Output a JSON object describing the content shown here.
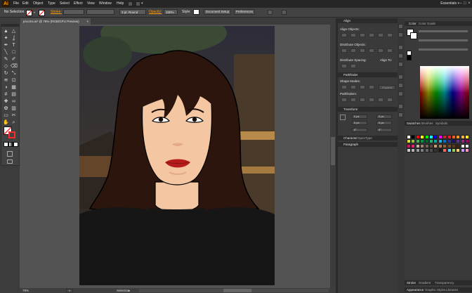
{
  "app": {
    "logo": "Ai",
    "workspace": "Essentials"
  },
  "menu": [
    "File",
    "Edit",
    "Object",
    "Type",
    "Select",
    "Effect",
    "View",
    "Window",
    "Help"
  ],
  "control_bar": {
    "selection_status": "No Selection",
    "stroke_label": "Stroke:",
    "stroke_value": "",
    "brush_label": "3 pt. Round",
    "opacity_label": "Opacity:",
    "opacity_value": "100%",
    "style_label": "Style:",
    "document_setup": "Document Setup",
    "preferences": "Preferences",
    "fill_color": "#ffffff",
    "stroke_color": "#ff0000"
  },
  "document": {
    "tab_title": "procms.ai* @ 78% (RGB/GPU Preview)",
    "zoom": "78%",
    "status_tool": "Selection",
    "page_number": "1"
  },
  "panels": {
    "align": {
      "title": "Align",
      "align_objects": "Align Objects:",
      "distribute_objects": "Distribute Objects:",
      "distribute_spacing": "Distribute Spacing:",
      "align_to": "Align To:"
    },
    "pathfinder": {
      "title": "Pathfinder",
      "shape_modes": "Shape Modes:",
      "expand": "Expand",
      "pathfinders": "Pathfinders:"
    },
    "transform": {
      "title": "Transform",
      "x_value": "0 px",
      "y_value": "0 px",
      "w_value": "0 px",
      "h_value": "0 px",
      "angle_value": "0°",
      "shear_value": "0°"
    },
    "character": {
      "title": "Character",
      "tab2": "OpenType"
    },
    "paragraph": {
      "title": "Paragraph"
    },
    "color": {
      "title": "Color",
      "tab2": "Color Guide"
    },
    "swatches": {
      "title": "Swatches",
      "tab2": "Brushes",
      "tab3": "Symbols"
    },
    "stroke_group": {
      "title": "Stroke",
      "tab2": "Gradient",
      "tab3": "Transparency"
    },
    "appearance_group": {
      "title": "Appearance",
      "tab2": "Graphic Styles",
      "tab3": "Libraries"
    }
  },
  "colors": {
    "hair": "#2b150d",
    "skin": "#f4c7a2",
    "lips": "#b51c1c",
    "shirt": "#161616",
    "accent": "#ff9a00"
  },
  "icons": {
    "tool_icons": [
      "selection",
      "direct-selection",
      "magic-wand",
      "lasso",
      "pen",
      "type",
      "line",
      "rectangle",
      "paintbrush",
      "pencil",
      "shaper",
      "eraser",
      "rotate",
      "scale",
      "width",
      "free-transform",
      "shape-builder",
      "perspective",
      "mesh",
      "gradient",
      "eyedropper",
      "blend",
      "symbol-sprayer",
      "column-graph",
      "artboard",
      "slice",
      "hand",
      "zoom"
    ]
  }
}
